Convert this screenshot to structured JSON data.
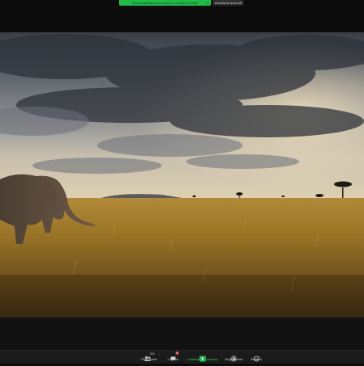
{
  "banner": {
    "sharing_text": "Stai visualizzando lo schermo di Marco Santini",
    "view_options_label": "Visualizza opzioni"
  },
  "toolbar": {
    "participants_label": "Partecipanti",
    "participants_count": "104",
    "chat_label": "Chatbox",
    "chat_badge": "3",
    "share_label": "Condividere lo schermo",
    "record_label": "Registrazione",
    "reactions_label": "Reazioni"
  },
  "colors": {
    "share_green": "#1fbd48",
    "toolbar_bg": "#1b1b1b",
    "window_bg": "#0c0c0c"
  },
  "icons": [
    "participants-icon",
    "chat-icon",
    "share-screen-icon",
    "record-icon",
    "reactions-icon",
    "chevron-down-icon"
  ]
}
